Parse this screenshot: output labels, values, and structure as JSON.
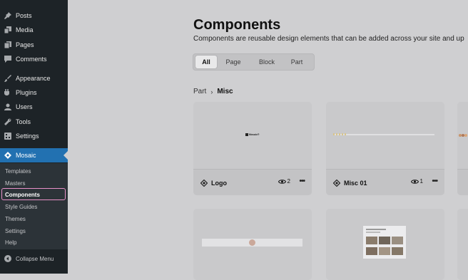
{
  "sidebar": {
    "items": [
      {
        "label": "Posts",
        "icon": "pin-icon"
      },
      {
        "label": "Media",
        "icon": "media-icon"
      },
      {
        "label": "Pages",
        "icon": "pages-icon"
      },
      {
        "label": "Comments",
        "icon": "comment-icon"
      },
      {
        "label": "Appearance",
        "icon": "brush-icon"
      },
      {
        "label": "Plugins",
        "icon": "plugin-icon"
      },
      {
        "label": "Users",
        "icon": "user-icon"
      },
      {
        "label": "Tools",
        "icon": "wrench-icon"
      },
      {
        "label": "Settings",
        "icon": "settings-icon"
      },
      {
        "label": "Mosaic",
        "icon": "diamond-icon"
      }
    ],
    "submenu": [
      "Templates",
      "Masters",
      "Components",
      "Style Guides",
      "Themes",
      "Settings",
      "Help"
    ],
    "collapse_label": "Collapse Menu"
  },
  "main": {
    "title": "Components",
    "subtitle": "Components are reusable design elements that can be added across your site and up",
    "tabs": [
      "All",
      "Page",
      "Block",
      "Part"
    ],
    "breadcrumb": {
      "parent": "Part",
      "current": "Misc"
    },
    "cards": [
      {
        "name": "Logo",
        "count": "2"
      },
      {
        "name": "Misc 01",
        "count": "1"
      }
    ],
    "logo_preview_text": "Mosaic®"
  },
  "colors": {
    "sidebar_bg": "#1d2327",
    "active_menu": "#2271b1",
    "highlight_outline": "#e891c8",
    "page_bg": "#cfcfd1"
  }
}
